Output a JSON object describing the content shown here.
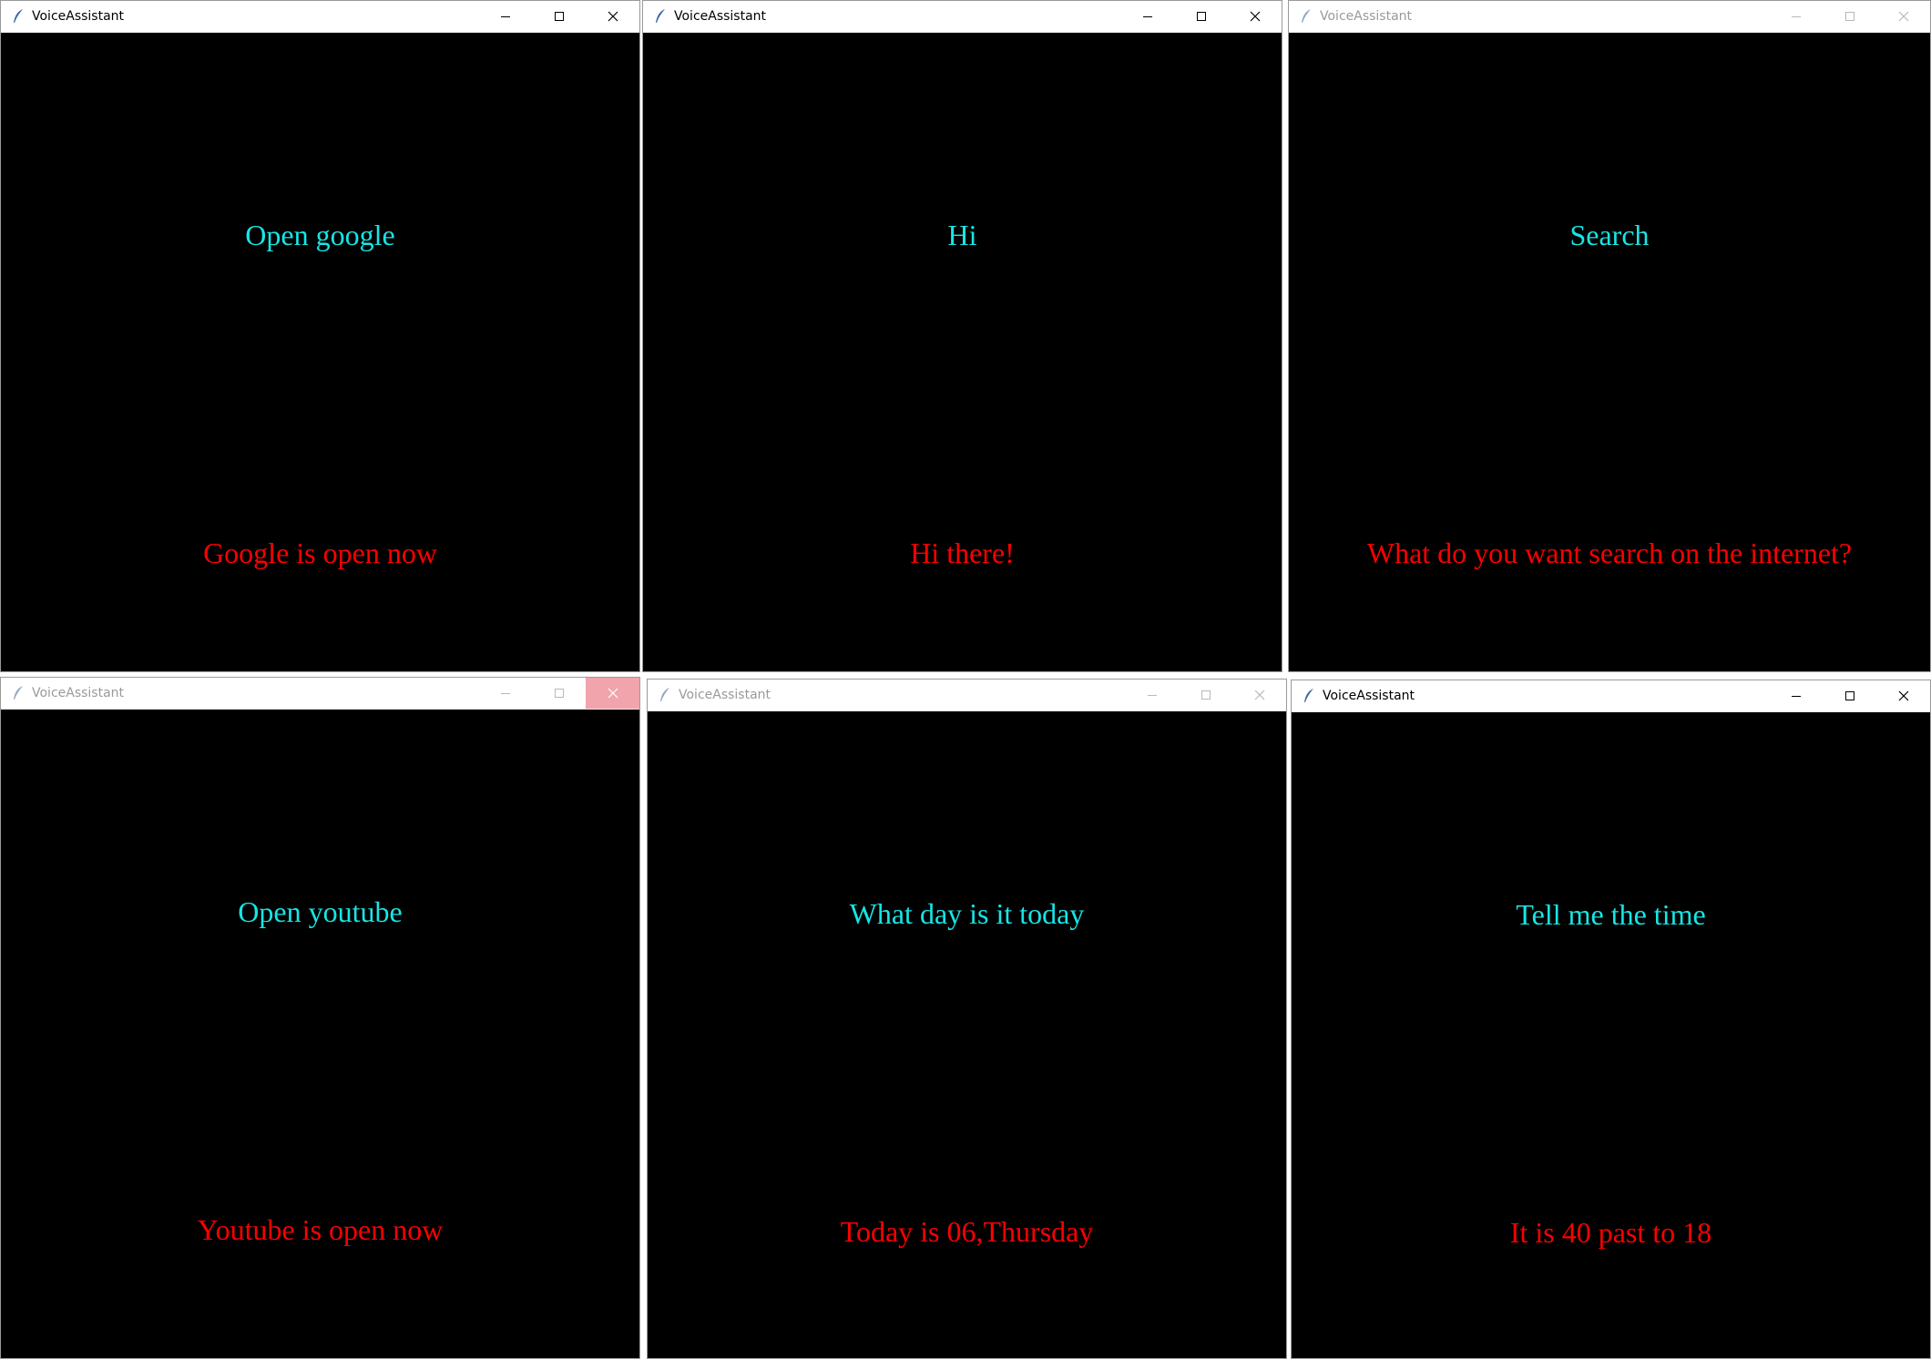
{
  "colors": {
    "command": "#17e6e6",
    "reply": "#ff0000",
    "background": "#000000",
    "close_hover": "#f1a4ab"
  },
  "windows": [
    {
      "title": "VoiceAssistant",
      "state": "active",
      "icon": "feather-icon",
      "command": "Open google",
      "reply": "Google is open now"
    },
    {
      "title": "VoiceAssistant",
      "state": "active",
      "icon": "feather-icon",
      "command": "Hi",
      "reply": "Hi there!"
    },
    {
      "title": "VoiceAssistant",
      "state": "inactive",
      "icon": "feather-icon",
      "command": "Search",
      "reply": "What do you want search on the internet?"
    },
    {
      "title": "VoiceAssistant",
      "state": "inactive, close button hovered",
      "icon": "feather-icon",
      "command": "Open youtube",
      "reply": "Youtube is open now"
    },
    {
      "title": "VoiceAssistant",
      "state": "inactive",
      "icon": "feather-icon",
      "command": "What day is it today",
      "reply": "Today is 06,Thursday"
    },
    {
      "title": "VoiceAssistant",
      "state": "active",
      "icon": "feather-icon",
      "command": "Tell me the time",
      "reply": "It is 40 past to 18"
    }
  ]
}
